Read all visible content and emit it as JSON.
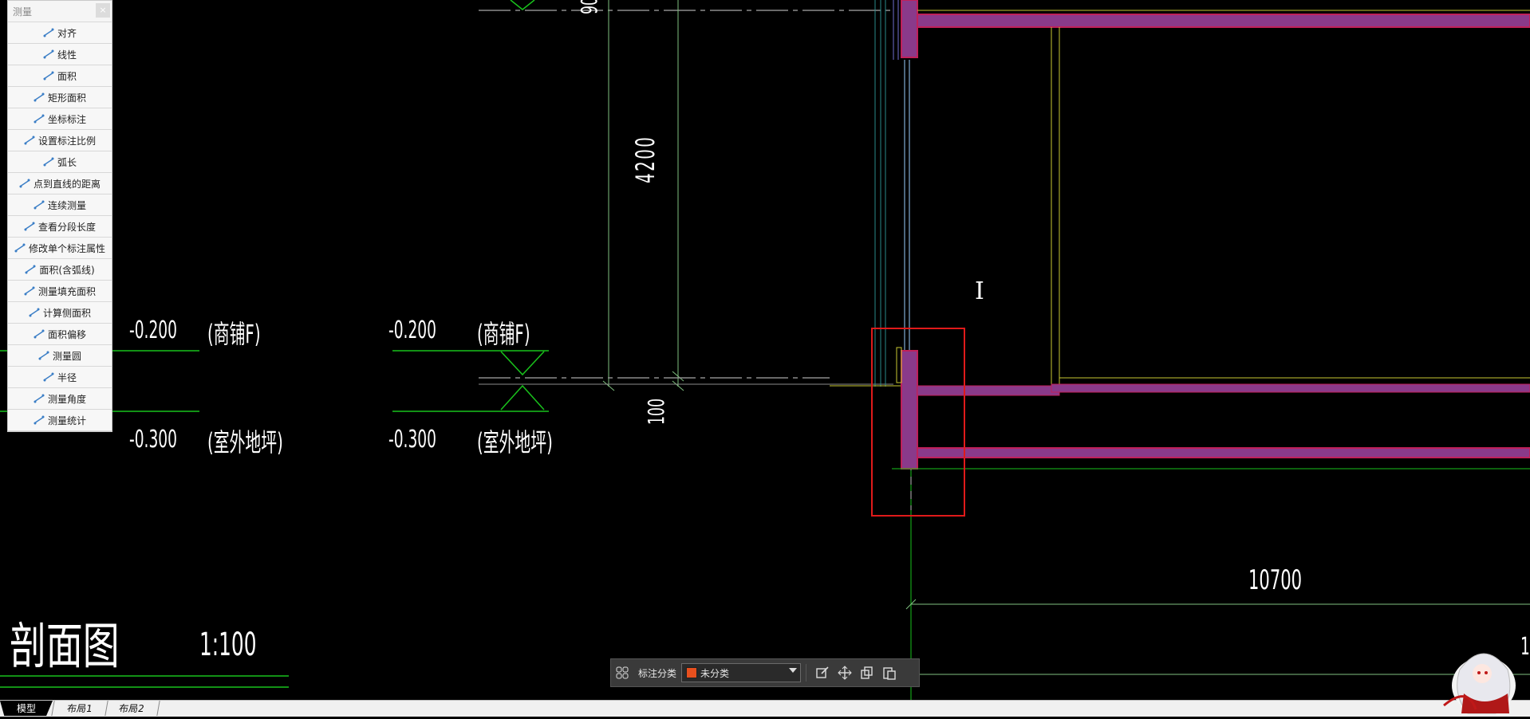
{
  "panel": {
    "title": "测量",
    "close_label": "×",
    "items": [
      {
        "label": "对齐",
        "icon": "aligned-dimension-icon"
      },
      {
        "label": "线性",
        "icon": "linear-dimension-icon"
      },
      {
        "label": "面积",
        "icon": "area-icon"
      },
      {
        "label": "矩形面积",
        "icon": "rectangle-area-icon"
      },
      {
        "label": "坐标标注",
        "icon": "coordinate-icon"
      },
      {
        "label": "设置标注比例",
        "icon": "scale-icon"
      },
      {
        "label": "弧长",
        "icon": "arc-length-icon"
      },
      {
        "label": "点到直线的距离",
        "icon": "point-to-line-icon"
      },
      {
        "label": "连续测量",
        "icon": "continuous-measure-icon"
      },
      {
        "label": "查看分段长度",
        "icon": "segment-length-icon"
      },
      {
        "label": "修改单个标注属性",
        "icon": "edit-dimension-icon"
      },
      {
        "label": "面积(含弧线)",
        "icon": "arc-area-icon"
      },
      {
        "label": "测量填充面积",
        "icon": "fill-area-icon"
      },
      {
        "label": "计算侧面积",
        "icon": "side-area-icon"
      },
      {
        "label": "面积偏移",
        "icon": "area-offset-icon"
      },
      {
        "label": "测量圆",
        "icon": "circle-icon"
      },
      {
        "label": "半径",
        "icon": "radius-icon"
      },
      {
        "label": "测量角度",
        "icon": "angle-icon"
      },
      {
        "label": "测量统计",
        "icon": "statistics-icon"
      }
    ]
  },
  "drawing": {
    "elev_1a": "-0.200",
    "elev_1a_note": "(商铺F)",
    "elev_1b": "-0.300",
    "elev_1b_note": "(室外地坪)",
    "elev_2a": "-0.200",
    "elev_2a_note": "(商铺F)",
    "elev_2b": "-0.300",
    "elev_2b_note": "(室外地坪)",
    "dim_vertical": "4200",
    "dim_small": "100",
    "dim_top_partial": "90",
    "dim_horizontal": "10700",
    "dim_right_partial": "1",
    "section_title": "剖面图",
    "section_scale": "1:100",
    "cursor_glyph": "I"
  },
  "annotation_bar": {
    "label": "标注分类",
    "selected": "未分类",
    "swatch_color": "#e8501e"
  },
  "tabs": [
    "模型",
    "布局1",
    "布局2"
  ],
  "colors": {
    "wall": "#8a3a8a",
    "wall_border": "#c0205a",
    "highlight": "#e01a1a",
    "green": "#19c21c",
    "yellow": "#c8c832"
  }
}
